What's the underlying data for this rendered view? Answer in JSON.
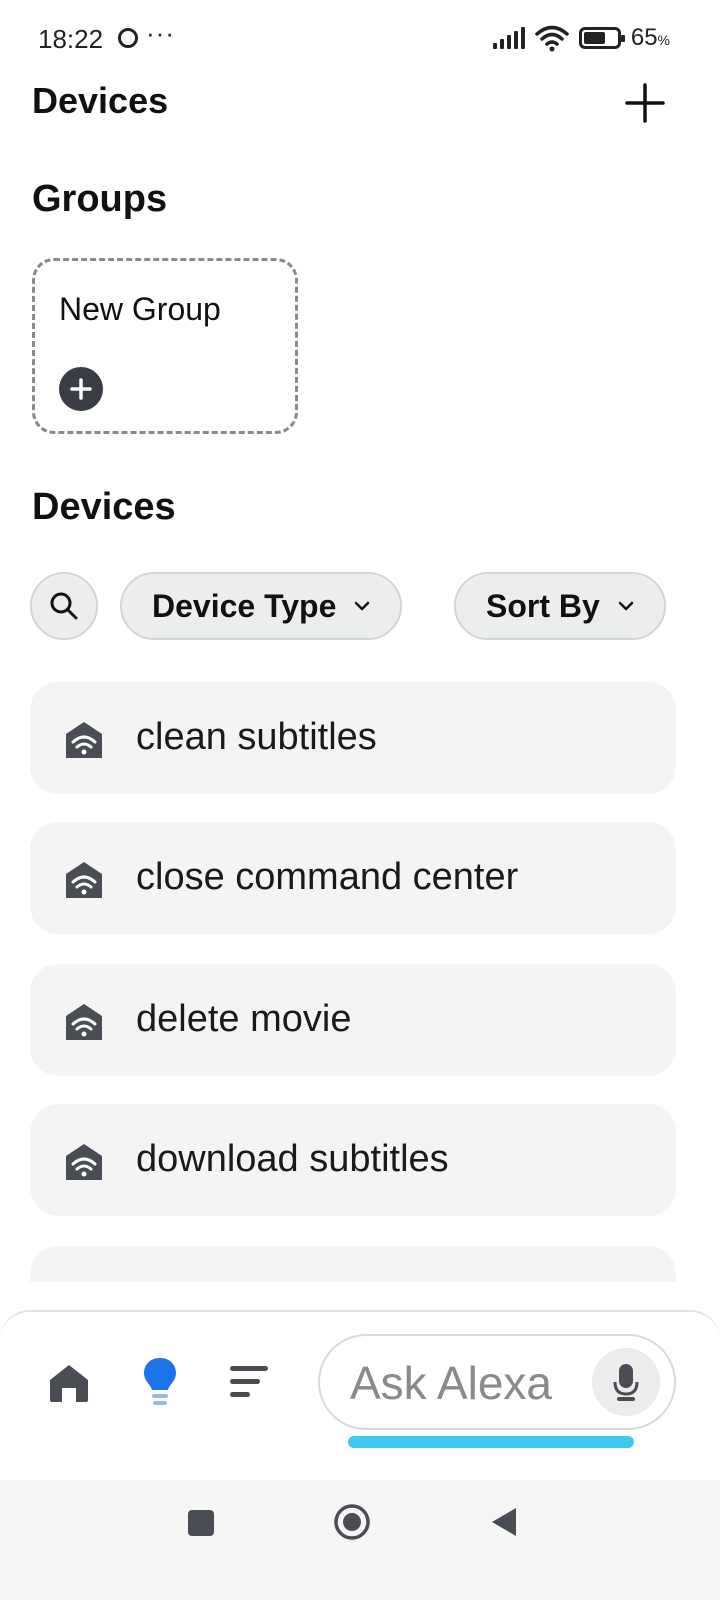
{
  "status_bar": {
    "time": "18:22",
    "more": "···",
    "battery_percent": 65,
    "battery_text": "65",
    "battery_unit": "%"
  },
  "header": {
    "title": "Devices",
    "add_icon": "plus-icon"
  },
  "groups": {
    "title": "Groups",
    "new_group_label": "New Group",
    "new_group_icon": "plus-circle-icon"
  },
  "devices": {
    "title": "Devices",
    "filters": [
      {
        "label": "Device Type",
        "icon": "chevron-down-icon"
      },
      {
        "label": "Sort By",
        "icon": "chevron-down-icon"
      }
    ],
    "items": [
      {
        "name": "clean subtitles",
        "icon": "smart-home-wifi-icon"
      },
      {
        "name": "close command center",
        "icon": "smart-home-wifi-icon"
      },
      {
        "name": "delete movie",
        "icon": "smart-home-wifi-icon"
      },
      {
        "name": "download subtitles",
        "icon": "smart-home-wifi-icon"
      }
    ]
  },
  "bottom_nav": {
    "ask_alexa_placeholder": "Ask Alexa",
    "active_color": "#1a73e8",
    "accent_color": "#3fc8f0"
  }
}
